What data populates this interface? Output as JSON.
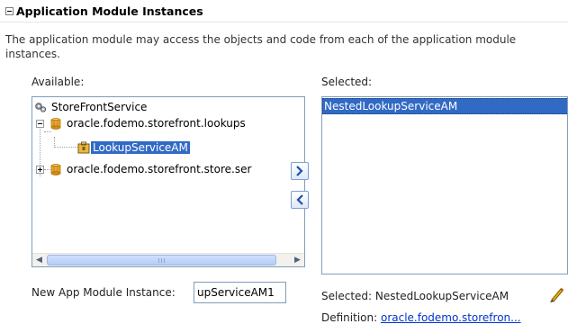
{
  "section": {
    "title": "Application Module Instances"
  },
  "description": "The application module may access the objects and code from each of the application module instances.",
  "available": {
    "label": "Available:",
    "tree": [
      {
        "label": "StoreFrontService",
        "icon": "service-icon"
      },
      {
        "label": "oracle.fodemo.storefront.lookups",
        "icon": "package-icon",
        "expanded": true
      },
      {
        "label": "LookupServiceAM",
        "icon": "app-module-icon",
        "selected": true
      },
      {
        "label": "oracle.fodemo.storefront.store.ser",
        "icon": "package-icon",
        "expanded": false
      }
    ]
  },
  "buttons": {
    "add_icon": "shuttle-right-icon",
    "remove_icon": "shuttle-left-icon"
  },
  "selected": {
    "label": "Selected:",
    "items": [
      "NestedLookupServiceAM"
    ]
  },
  "new_instance": {
    "label": "New App Module Instance:",
    "value": "upServiceAM1"
  },
  "details": {
    "selected_label": "Selected:",
    "selected_value": "NestedLookupServiceAM",
    "definition_label": "Definition:",
    "definition_value": "oracle.fodemo.storefron..."
  },
  "colors": {
    "selection": "#316ac5",
    "link": "#0033cc",
    "border": "#7f9db9"
  }
}
